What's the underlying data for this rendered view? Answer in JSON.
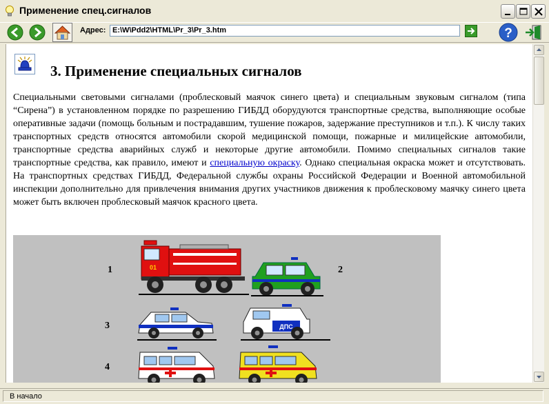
{
  "window": {
    "title": "Применение спец.сигналов"
  },
  "toolbar": {
    "address_label": "Адрес:",
    "address_value": "E:\\W\\Pdd2\\HTML\\Pr_3\\Pr_3.htm"
  },
  "content": {
    "heading": "3. Применение специальных сигналов",
    "paragraph_part1": "Специальными световыми сигналами (проблесковый маячок синего цвета) и специальным звуковым сигналом (типа “Сирена”) в установленном порядке по разрешению ГИБДД оборудуются транспортные средства, выполняющие особые оперативные задачи (помощь больным и пострадавшим, тушение пожаров, задержание преступников и т.п.). К числу таких транспортных средств относятся автомобили скорой медицинской помощи, пожарные и милицейские автомобили, транспортные средства аварийных служб и некоторые другие автомобили. Помимо специальных сигналов такие транспортные средства, как правило, имеют и ",
    "paragraph_link": "специальную окраску",
    "paragraph_part2": ". Однако специальная окраска может и отсутствовать. На транспортных средствах ГИБДД, Федеральной службы охраны Российской Федерации и Военной автомобильной инспекции дополнительно для привлечения внимания других участников движения к проблесковому маячку синего цвета может быть включен проблесковый маячок красного цвета.",
    "figure_labels": [
      "1",
      "2",
      "3",
      "4"
    ],
    "vehicle_texts": {
      "police_car": "ДПС",
      "police_suv": "ДПС",
      "fire_truck": "01"
    }
  },
  "status": {
    "text": "В начало"
  },
  "colors": {
    "fire_red": "#e01010",
    "police_blue": "#1030c0",
    "police_green": "#20a020",
    "ambulance_yellow": "#f0e020",
    "nav_green": "#3a9a2a"
  }
}
